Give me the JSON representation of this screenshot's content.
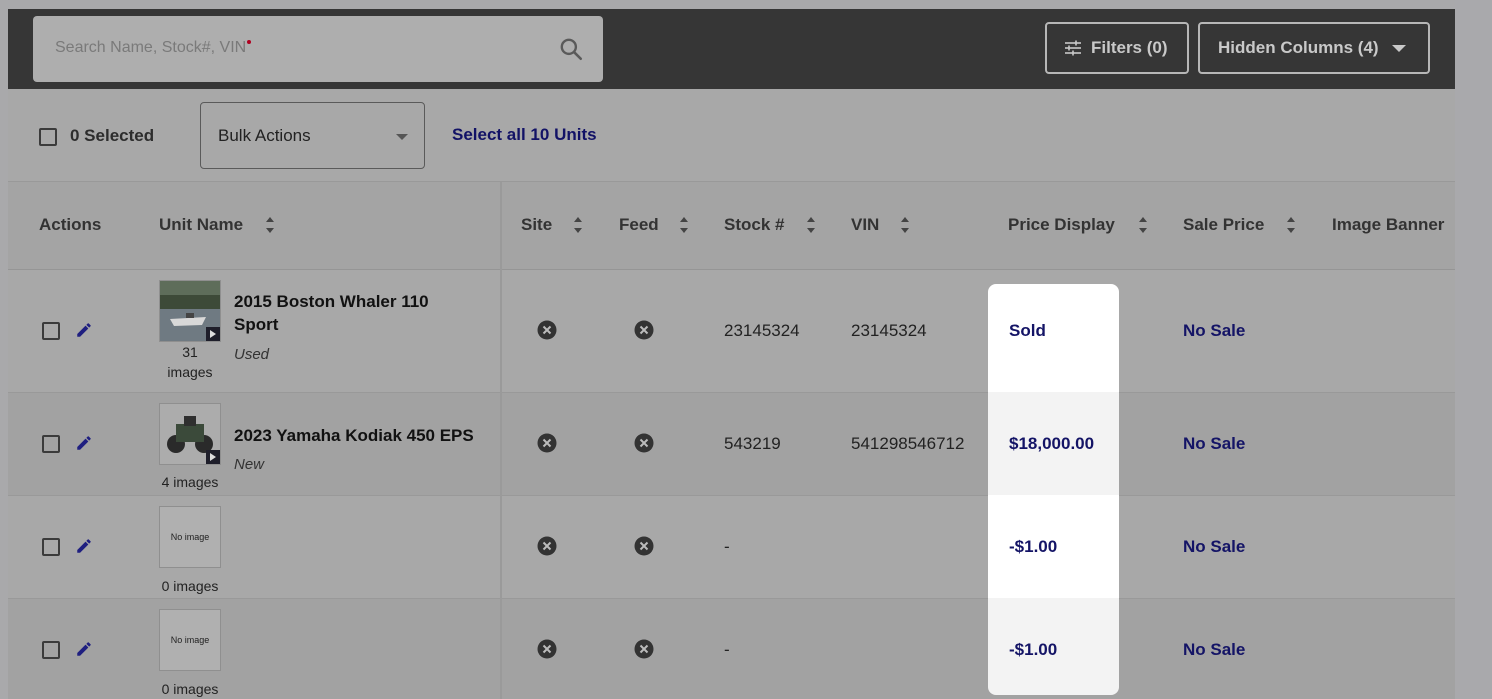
{
  "toolbar": {
    "search_placeholder": "Search Name, Stock#, VIN",
    "filters_label": "Filters (0)",
    "hidden_columns_label": "Hidden Columns (4)"
  },
  "selection": {
    "selected_label": "0 Selected",
    "bulk_actions_label": "Bulk Actions",
    "select_all_label": "Select all 10 Units"
  },
  "columns": {
    "actions": "Actions",
    "unit_name": "Unit Name",
    "site": "Site",
    "feed": "Feed",
    "stock": "Stock #",
    "vin": "VIN",
    "price_display": "Price Display",
    "sale_price": "Sale Price",
    "image_banner": "Image Banner"
  },
  "rows": [
    {
      "image_count": "31",
      "image_count_suffix": "images",
      "name_line1": "2015 Boston Whaler 110",
      "name_line2": "Sport",
      "condition": "Used",
      "stock": "23145324",
      "vin": "23145324",
      "price_display": "Sold",
      "sale_price": "No Sale"
    },
    {
      "image_count": "4 images",
      "name_line1": "2023 Yamaha Kodiak 450 EPS",
      "condition": "New",
      "stock": "543219",
      "vin": "541298546712",
      "price_display": "$18,000.00",
      "sale_price": "No Sale"
    },
    {
      "image_count": "0 images",
      "thumb_text": "No image",
      "stock": "-",
      "vin": "",
      "price_display": "-$1.00",
      "sale_price": "No Sale"
    },
    {
      "image_count": "0 images",
      "thumb_text": "No image",
      "stock": "-",
      "vin": "",
      "price_display": "-$1.00",
      "sale_price": "No Sale"
    }
  ],
  "colors": {
    "toolbar_bg": "#363636",
    "link": "#141466",
    "highlight": "#ffffff"
  },
  "icons": [
    "search-icon",
    "filter-sliders-icon",
    "chevron-down-icon",
    "edit-pencil-icon",
    "circle-x-icon",
    "play-icon"
  ]
}
